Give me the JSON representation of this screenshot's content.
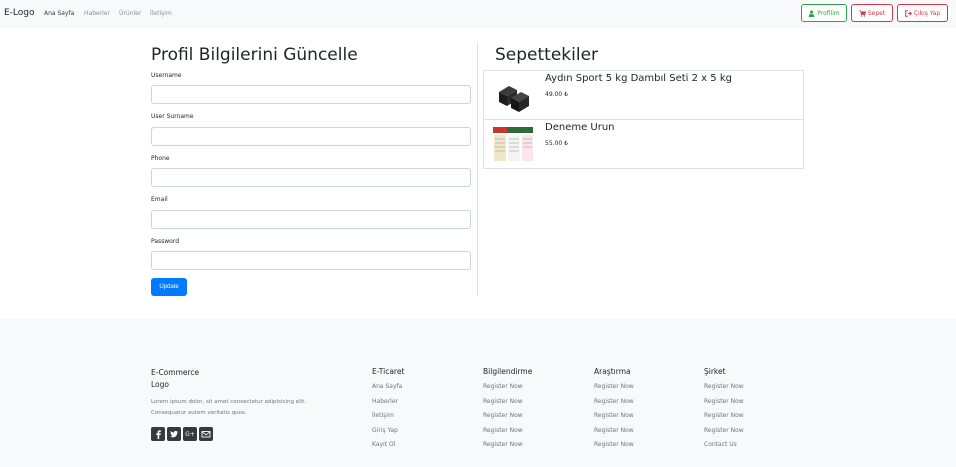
{
  "navbar": {
    "brand": "E-Logo",
    "links": [
      "Ana Sayfa",
      "Haberler",
      "Ürünler",
      "İletişim"
    ],
    "buttons": {
      "profile": "Profilim",
      "cart": "Sepet",
      "logout": "Çıkış Yap"
    }
  },
  "profile_form": {
    "title": "Profil Bilgilerini Güncelle",
    "fields": [
      {
        "label": "Username",
        "value": ""
      },
      {
        "label": "User Surname",
        "value": ""
      },
      {
        "label": "Phone",
        "value": ""
      },
      {
        "label": "Email",
        "value": ""
      },
      {
        "label": "Password",
        "value": ""
      }
    ],
    "submit_label": "Update"
  },
  "cart": {
    "title": "Sepettekiler",
    "items": [
      {
        "name": "Aydın Sport 5 kg Dambıl Seti 2 x 5 kg",
        "price": "49.00 ₺"
      },
      {
        "name": "Deneme Urun",
        "price": "55.00 ₺"
      }
    ]
  },
  "footer": {
    "brand": {
      "logo": "E-Commerce Logo",
      "description": "Lorem ipsum dolor, sit amet consectetur adipisicing elit. Consequatur autem veritatis quos."
    },
    "social_icons": [
      "facebook-icon",
      "twitter-icon",
      "google-plus-icon",
      "mail-icon"
    ],
    "columns": [
      {
        "title": "E-Ticaret",
        "links": [
          "Ana Sayfa",
          "Haberler",
          "İletişim",
          "Giriş Yap",
          "Kayıt Ol"
        ]
      },
      {
        "title": "Bilgilendirme",
        "links": [
          "Register Now",
          "Register Now",
          "Register Now",
          "Register Now",
          "Register Now"
        ]
      },
      {
        "title": "Araştırma",
        "links": [
          "Register Now",
          "Register Now",
          "Register Now",
          "Register Now",
          "Register Now"
        ]
      },
      {
        "title": "Şirket",
        "links": [
          "Register Now",
          "Register Now",
          "Register Now",
          "Register Now",
          "Contact Us"
        ]
      }
    ]
  },
  "colors": {
    "primary": "#007bff",
    "success": "#28a745",
    "danger": "#dc3545",
    "light_bg": "#f8f9fa"
  }
}
